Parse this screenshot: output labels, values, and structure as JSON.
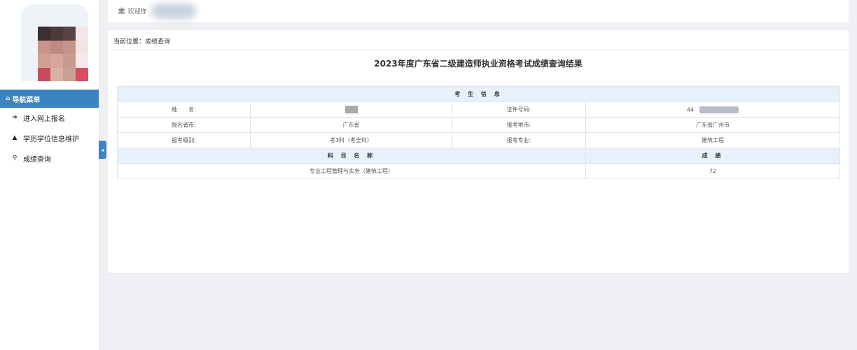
{
  "header": {
    "welcome_text": "欢迎你"
  },
  "breadcrumb": {
    "text": "当前位置：成绩查询"
  },
  "sidebar": {
    "nav_title": "导航菜单",
    "items": [
      {
        "label": "进入网上报名",
        "icon": "sign-in-icon"
      },
      {
        "label": "学历学位信息维护",
        "icon": "graduation-cap-icon"
      },
      {
        "label": "成绩查询",
        "icon": "search-icon"
      }
    ]
  },
  "main": {
    "title": "2023年度广东省二级建造师执业资格考试成绩查询结果",
    "candidate_section_title": "考 生 信 息",
    "fields": {
      "name_label": "姓　　名:",
      "name_value": "",
      "id_label": "证件号码:",
      "id_value": "44",
      "province_label": "报名省市:",
      "province_value": "广东省",
      "city_label": "报考地市:",
      "city_value": "广东省广州市",
      "level_label": "报考级别:",
      "level_value": "考3科（考全科）",
      "major_label": "报考专业:",
      "major_value": "建筑工程"
    },
    "scores": {
      "subject_header": "科 目 名 称",
      "score_header": "成 绩",
      "rows": [
        {
          "subject": "专业工程管理与实务（建筑工程）",
          "score": "72"
        }
      ]
    }
  },
  "colors": {
    "accent": "#3b84c4",
    "section_bg": "#e7f1fb",
    "page_bg": "#eef0f3"
  }
}
